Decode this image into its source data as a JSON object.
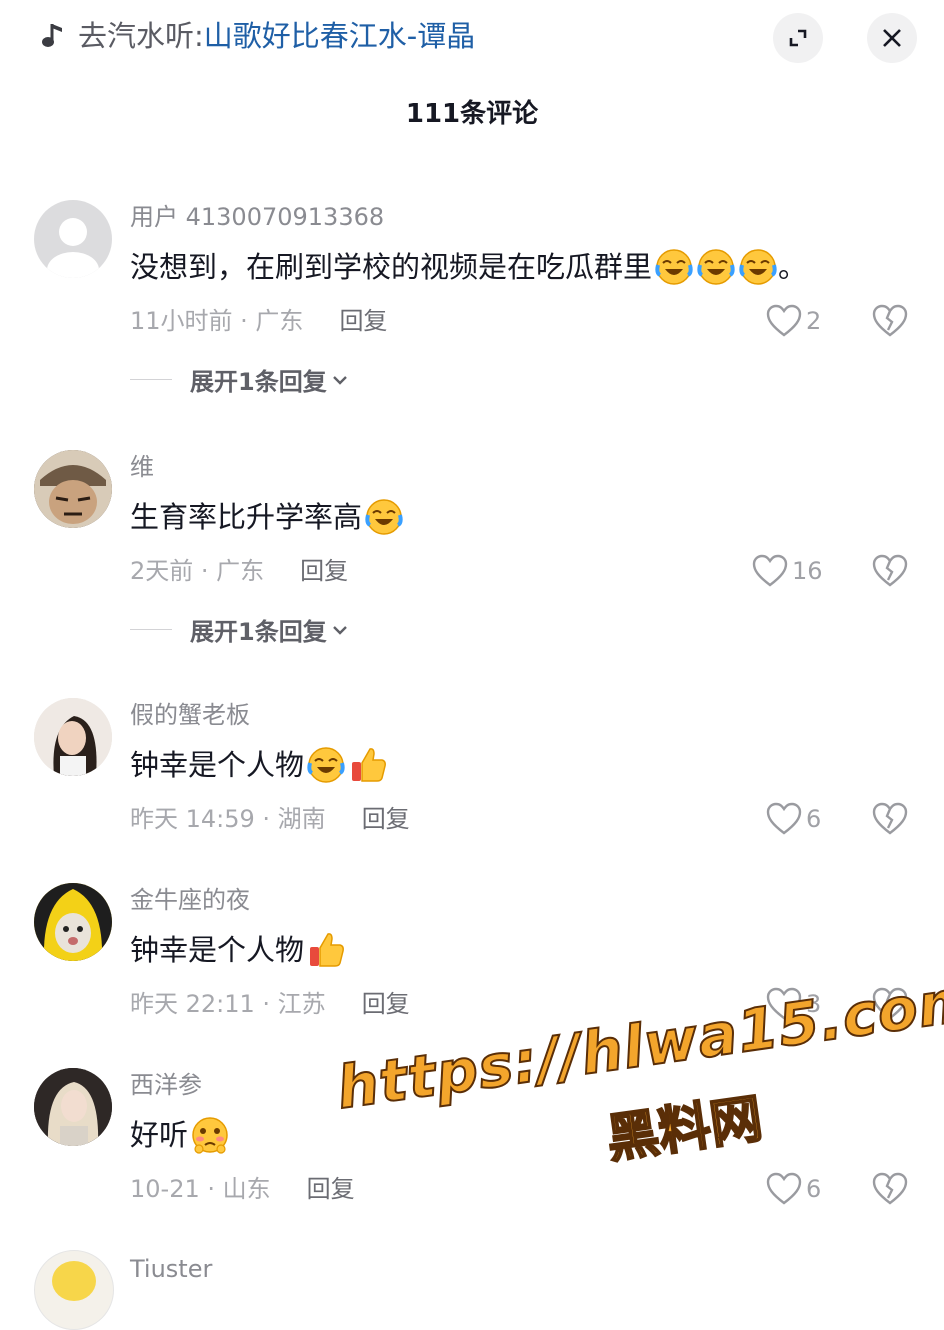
{
  "music": {
    "prefix": "去汽水听:",
    "title": "山歌好比春江水-谭晶"
  },
  "header": {
    "title": "111条评论"
  },
  "comments": [
    {
      "user": "用户 4130070913368",
      "text": "没想到，在刷到学校的视频是在吃瓜群里",
      "emojis": [
        "laughing-crying",
        "laughing-crying",
        "laughing-crying"
      ],
      "tail": "。",
      "time": "11小时前 · 广东",
      "reply": "回复",
      "likes": "2",
      "expand": "展开1条回复"
    },
    {
      "user": "维",
      "text": "生育率比升学率高",
      "emojis": [
        "laughing-crying"
      ],
      "tail": "",
      "time": "2天前 · 广东",
      "reply": "回复",
      "likes": "16",
      "expand": "展开1条回复"
    },
    {
      "user": "假的蟹老板",
      "text": "钟幸是个人物",
      "emojis": [
        "laughing-crying",
        "thumbs-up"
      ],
      "tail": "",
      "time": "昨天 14:59 · 湖南",
      "reply": "回复",
      "likes": "6"
    },
    {
      "user": "金牛座的夜",
      "text": "钟幸是个人物",
      "emojis": [
        "thumbs-up"
      ],
      "tail": "",
      "time": "昨天 22:11 · 江苏",
      "reply": "回复",
      "likes": "3"
    },
    {
      "user": "西洋参",
      "text": "好听",
      "emojis": [
        "shy-face"
      ],
      "tail": "",
      "time": "10-21 · 山东",
      "reply": "回复",
      "likes": "6"
    },
    {
      "user": "Tiuster"
    }
  ],
  "watermark": {
    "url": "https://hlwa15.com",
    "site": "黑料网"
  },
  "colors": {
    "accent_blue": "#1f5fa6",
    "muted": "#8a8b91",
    "watermark": "#f3a52c"
  }
}
